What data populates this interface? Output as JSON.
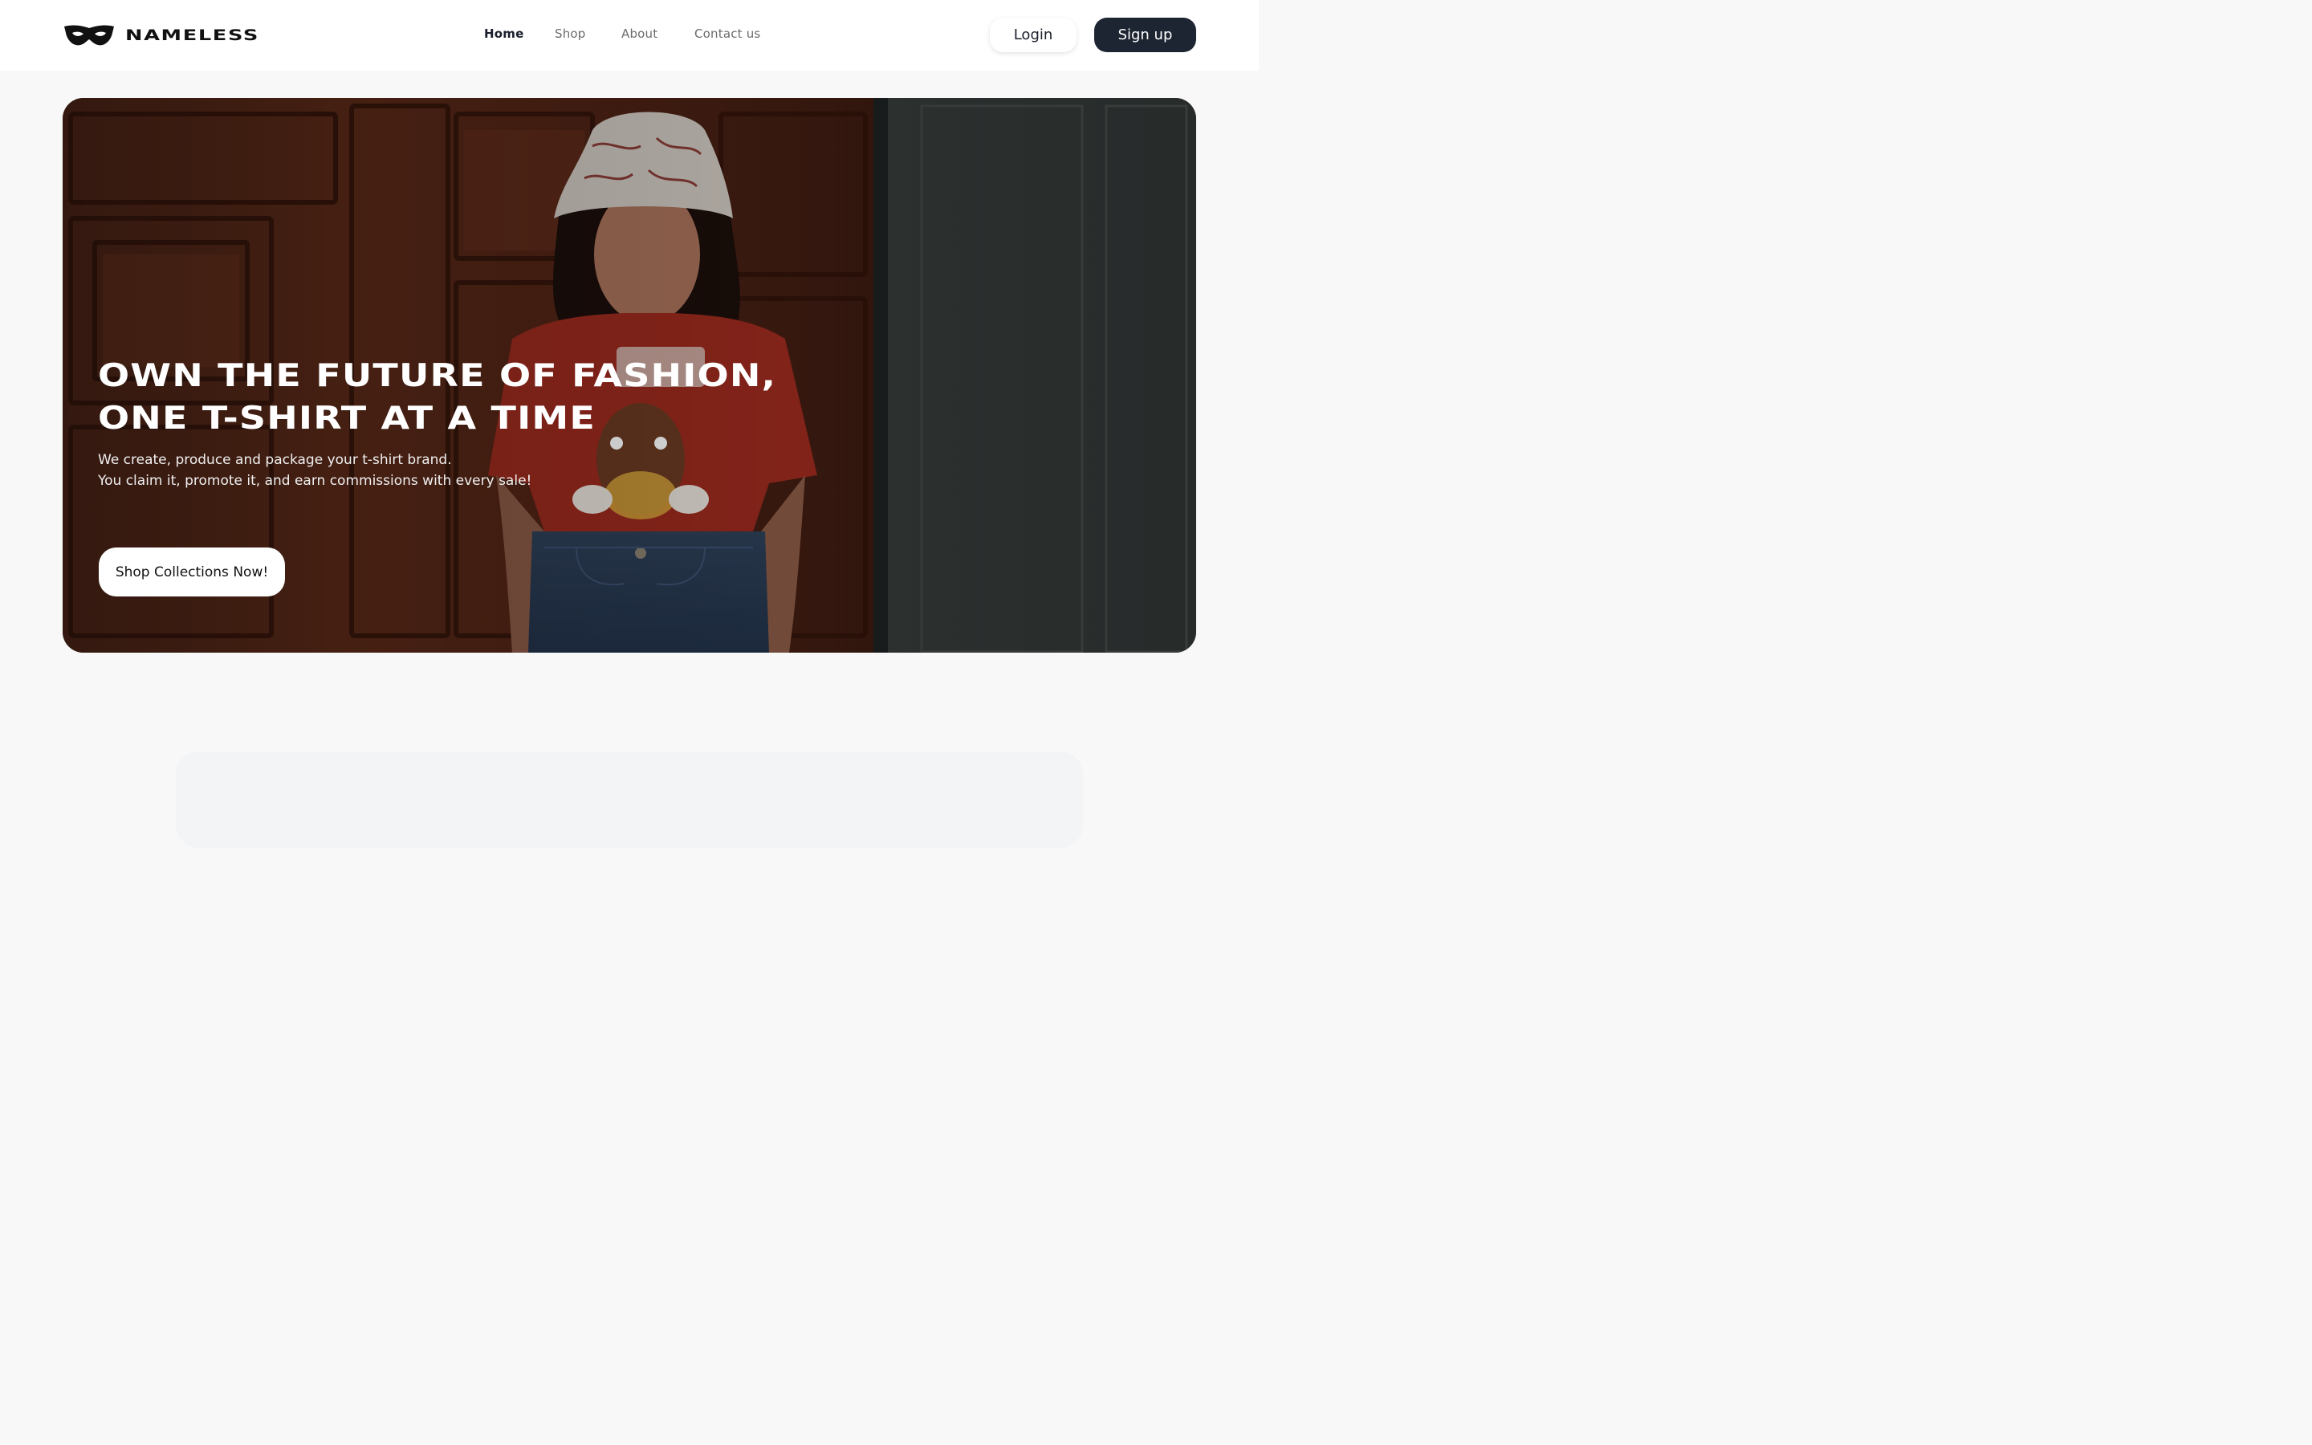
{
  "brand": {
    "name": "NAMELESS",
    "logo_icon": "mask-icon"
  },
  "nav": {
    "links": [
      {
        "label": "Home",
        "active": true
      },
      {
        "label": "Shop",
        "active": false
      },
      {
        "label": "About",
        "active": false
      },
      {
        "label": "Contact us",
        "active": false
      }
    ]
  },
  "auth": {
    "login_label": "Login",
    "signup_label": "Sign up"
  },
  "hero": {
    "title_line1": "OWN THE FUTURE OF FASHION,",
    "title_line2": "ONE T-SHIRT AT A TIME",
    "subtitle_line1": "We create, produce and package your t-shirt brand.",
    "subtitle_line2": "You claim it, promote it, and earn commissions with every sale!",
    "cta_label": "Shop Collections Now!",
    "image_subject": "person-wearing-bucket-hat-and-red-tshirt"
  },
  "colors": {
    "primary_dark": "#1e2532",
    "background": "#f8f8f8",
    "white": "#ffffff",
    "nav_inactive": "#6b6b6b"
  }
}
